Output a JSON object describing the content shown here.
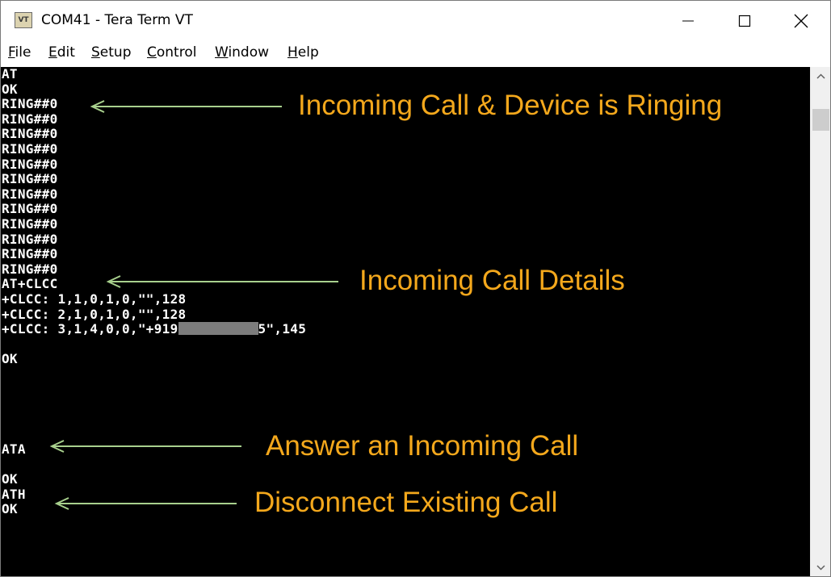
{
  "window": {
    "icon_text": "VT",
    "title": "COM41 - Tera Term VT"
  },
  "menu": [
    {
      "first": "F",
      "rest": "ile"
    },
    {
      "first": "E",
      "rest": "dit"
    },
    {
      "first": "S",
      "rest": "etup"
    },
    {
      "first": "C",
      "rest": "ontrol"
    },
    {
      "first": "W",
      "rest": "indow"
    },
    {
      "first": "H",
      "rest": "elp"
    }
  ],
  "terminal": {
    "lines": [
      "AT",
      "OK",
      "RING##0",
      "RING##0",
      "RING##0",
      "RING##0",
      "RING##0",
      "RING##0",
      "RING##0",
      "RING##0",
      "RING##0",
      "RING##0",
      "RING##0",
      "RING##0",
      "AT+CLCC",
      "+CLCC: 1,1,0,1,0,\"\",128",
      "+CLCC: 2,1,0,1,0,\"\",128"
    ],
    "clcc3_prefix": "+CLCC: 3,1,4,0,0,\"+919",
    "clcc3_suffix": "5\",145",
    "ok_after_clcc": "OK",
    "ata": "ATA",
    "ok_after_ata": "OK",
    "ath": "ATH",
    "ok_after_ath": "OK"
  },
  "annotations": {
    "ringing": "Incoming Call & Device is Ringing",
    "call_details": "Incoming Call Details",
    "answer": "Answer an Incoming Call",
    "disconnect": "Disconnect Existing Call",
    "text_color": "#f4a81c",
    "arrow_color": "#a8d08d"
  }
}
